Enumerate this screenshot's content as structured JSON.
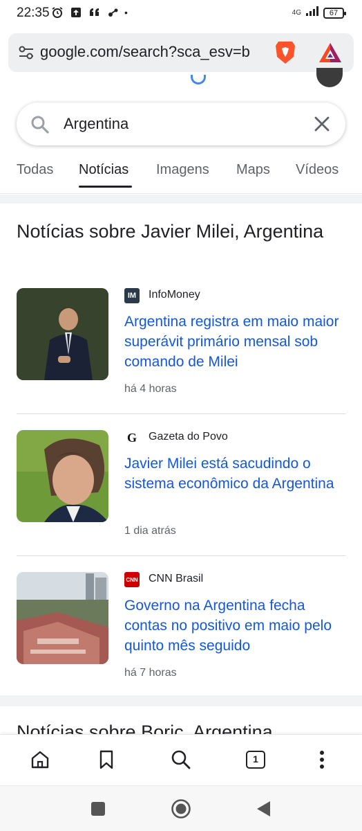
{
  "status_bar": {
    "time": "22:35",
    "network": "4G",
    "battery": "67"
  },
  "browser": {
    "url": "google.com/search?sca_esv=b",
    "tabs_count": "1"
  },
  "search": {
    "query": "Argentina"
  },
  "tabs": [
    {
      "label": "Todas"
    },
    {
      "label": "Notícias"
    },
    {
      "label": "Imagens"
    },
    {
      "label": "Maps"
    },
    {
      "label": "Vídeos"
    }
  ],
  "card": {
    "title": "Notícias sobre Javier Milei, Argentina",
    "items": [
      {
        "source": "InfoMoney",
        "source_logo": "IM",
        "source_color": "#2b3a4a",
        "headline": "Argentina registra em maio maior superávit primário mensal sob comando de Milei",
        "time": "há 4 horas"
      },
      {
        "source": "Gazeta do Povo",
        "source_logo": "G",
        "source_color": "#ffffff",
        "headline": "Javier Milei está sacudindo o sistema econômico da Argentina",
        "time": "1 dia atrás"
      },
      {
        "source": "CNN Brasil",
        "source_logo": "CNN",
        "source_color": "#cc0000",
        "headline": "Governo na Argentina fecha contas no positivo em maio pelo quinto mês seguido",
        "time": "há 7 horas"
      }
    ]
  },
  "next_card": {
    "title": "Notícias sobre Boric, Argentina"
  },
  "colors": {
    "link": "#1558d6",
    "tab_active": "#202124",
    "gutter": "#f1f3f4"
  }
}
